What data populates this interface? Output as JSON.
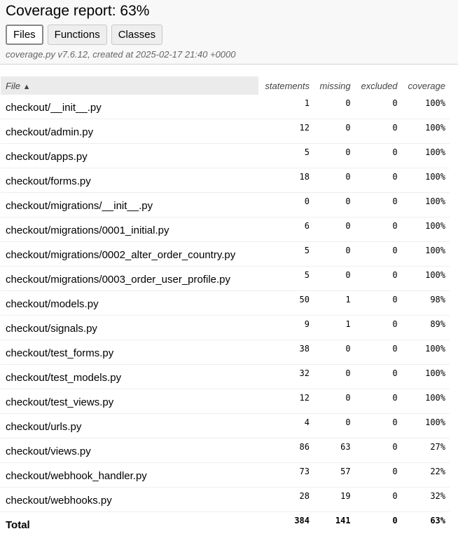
{
  "header": {
    "title": "Coverage report: 63%",
    "tabs": [
      {
        "label": "Files",
        "active": true
      },
      {
        "label": "Functions",
        "active": false
      },
      {
        "label": "Classes",
        "active": false
      }
    ],
    "meta": "coverage.py v7.6.12, created at 2025-02-17 21:40 +0000"
  },
  "table": {
    "columns": {
      "file": "File",
      "sort_indicator": "▲",
      "statements": "statements",
      "missing": "missing",
      "excluded": "excluded",
      "coverage": "coverage"
    },
    "rows": [
      {
        "file": "checkout/__init__.py",
        "statements": "1",
        "missing": "0",
        "excluded": "0",
        "coverage": "100%"
      },
      {
        "file": "checkout/admin.py",
        "statements": "12",
        "missing": "0",
        "excluded": "0",
        "coverage": "100%"
      },
      {
        "file": "checkout/apps.py",
        "statements": "5",
        "missing": "0",
        "excluded": "0",
        "coverage": "100%"
      },
      {
        "file": "checkout/forms.py",
        "statements": "18",
        "missing": "0",
        "excluded": "0",
        "coverage": "100%"
      },
      {
        "file": "checkout/migrations/__init__.py",
        "statements": "0",
        "missing": "0",
        "excluded": "0",
        "coverage": "100%"
      },
      {
        "file": "checkout/migrations/0001_initial.py",
        "statements": "6",
        "missing": "0",
        "excluded": "0",
        "coverage": "100%"
      },
      {
        "file": "checkout/migrations/0002_alter_order_country.py",
        "statements": "5",
        "missing": "0",
        "excluded": "0",
        "coverage": "100%"
      },
      {
        "file": "checkout/migrations/0003_order_user_profile.py",
        "statements": "5",
        "missing": "0",
        "excluded": "0",
        "coverage": "100%"
      },
      {
        "file": "checkout/models.py",
        "statements": "50",
        "missing": "1",
        "excluded": "0",
        "coverage": "98%"
      },
      {
        "file": "checkout/signals.py",
        "statements": "9",
        "missing": "1",
        "excluded": "0",
        "coverage": "89%"
      },
      {
        "file": "checkout/test_forms.py",
        "statements": "38",
        "missing": "0",
        "excluded": "0",
        "coverage": "100%"
      },
      {
        "file": "checkout/test_models.py",
        "statements": "32",
        "missing": "0",
        "excluded": "0",
        "coverage": "100%"
      },
      {
        "file": "checkout/test_views.py",
        "statements": "12",
        "missing": "0",
        "excluded": "0",
        "coverage": "100%"
      },
      {
        "file": "checkout/urls.py",
        "statements": "4",
        "missing": "0",
        "excluded": "0",
        "coverage": "100%"
      },
      {
        "file": "checkout/views.py",
        "statements": "86",
        "missing": "63",
        "excluded": "0",
        "coverage": "27%"
      },
      {
        "file": "checkout/webhook_handler.py",
        "statements": "73",
        "missing": "57",
        "excluded": "0",
        "coverage": "22%"
      },
      {
        "file": "checkout/webhooks.py",
        "statements": "28",
        "missing": "19",
        "excluded": "0",
        "coverage": "32%"
      }
    ],
    "total": {
      "file": "Total",
      "statements": "384",
      "missing": "141",
      "excluded": "0",
      "coverage": "63%"
    }
  }
}
